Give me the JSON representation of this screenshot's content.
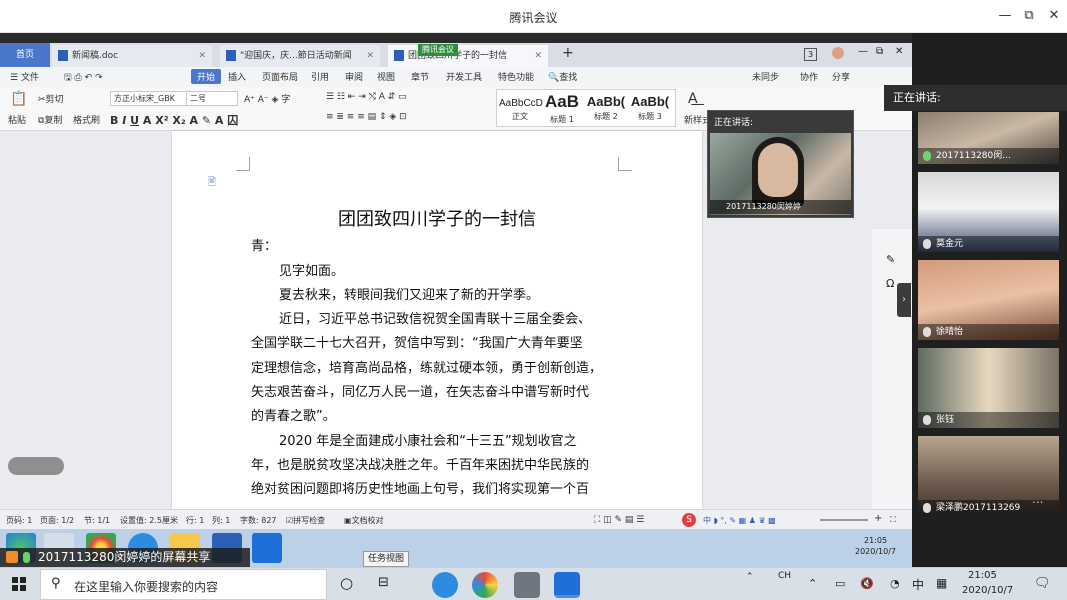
{
  "app": {
    "title": "腾讯会议"
  },
  "window_controls": {
    "minimize": "—",
    "restore": "⧉",
    "close": "✕"
  },
  "wps": {
    "tabs": [
      {
        "label": "首页"
      },
      {
        "label": "新闻稿.doc"
      },
      {
        "label": "\"迎国庆，庆...節日活动新闻"
      },
      {
        "label": "团团致四川学子的一封信"
      }
    ],
    "meeting_badge": "腾讯会议",
    "tab_count": "3",
    "menu": [
      "文件",
      "开始",
      "插入",
      "页面布局",
      "引用",
      "审阅",
      "视图",
      "章节",
      "开发工具",
      "特色功能",
      "查找"
    ],
    "menu_right": [
      "未同步",
      "协作",
      "分享"
    ],
    "ribbon": {
      "paste": "粘贴",
      "cut": "剪切",
      "copy": "复制",
      "format_painter": "格式刷",
      "font_name": "方正小标宋_GBK",
      "font_size": "二号",
      "styles": [
        {
          "sample": "AaBbCcD",
          "label": "正文"
        },
        {
          "sample": "AaB",
          "label": "标题 1"
        },
        {
          "sample": "AaBb(",
          "label": "标题 2"
        },
        {
          "sample": "AaBb(",
          "label": "标题 3"
        }
      ],
      "new_style": "新样式"
    },
    "document": {
      "title": "团团致四川学子的一封信",
      "lines": [
        "青：",
        "见字如面。",
        "夏去秋来，转眼间我们又迎来了新的开学季。",
        "近日，习近平总书记致信祝贺全国青联十三届全委会、",
        "全国学联二十七大召开，贺信中写到：“我国广大青年要坚",
        "定理想信念，培育高尚品格，练就过硬本领，勇于创新创造，",
        "矢志艰苦奋斗，同亿万人民一道，在矢志奋斗中谱写新时代",
        "的青春之歌”。",
        "2020 年是全面建成小康社会和“十三五”规划收官之",
        "年，也是脱贫攻坚决战决胜之年。千百年来困扰中华民族的",
        "绝对贫困问题即将历史性地画上句号，我们将实现第一个百"
      ]
    },
    "status": {
      "page_num": "页码: 1",
      "pages": "页面: 1/2",
      "section": "节: 1/1",
      "setting": "设置值: 2.5厘米",
      "row": "行: 1",
      "col": "列: 1",
      "words": "字数: 827",
      "spell": "拼写检查",
      "proof": "文档校对"
    },
    "inner_clock": {
      "time": "21:05",
      "date": "2020/10/7"
    }
  },
  "speaker_overlay": {
    "label": "正在讲话:",
    "name": "2017113280闵婷婷"
  },
  "participants": {
    "header": "正在讲话:",
    "list": [
      {
        "name": "2017113280闵...",
        "mic": "on"
      },
      {
        "name": "莫金元",
        "mic": "off"
      },
      {
        "name": "徐晴怡",
        "mic": "off"
      },
      {
        "name": "张钰",
        "mic": "off"
      },
      {
        "name": "梁泽鹏2017113269",
        "mic": "off"
      }
    ],
    "more": "..."
  },
  "share_banner": {
    "text": "2017113280闵婷婷的屏幕共享"
  },
  "tooltip": {
    "text": "任务视图"
  },
  "host_taskbar": {
    "search_placeholder": "在这里输入你要搜索的内容",
    "ime_top": "CH",
    "ime_mode": "中",
    "clock_time": "21:05",
    "clock_date": "2020/10/7"
  },
  "colors": {
    "wps_blue": "#4a77c9",
    "panel_bg": "#1f1f1f",
    "mic_active": "#6bd36b",
    "taskbar": "#d9dfe7"
  }
}
